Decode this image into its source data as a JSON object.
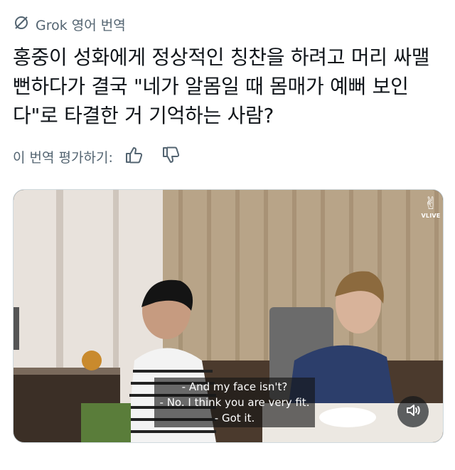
{
  "translate": {
    "label": "Grok 영어 번역"
  },
  "post": {
    "text": "홍중이 성화에게 정상적인 칭찬을 하려고 머리 싸맬 뻔하다가 결국 \"네가 알몸일 때 몸매가 예뻐 보인다\"로 타결한 거 기억하는 사람?"
  },
  "rating": {
    "label": "이 번역 평가하기:"
  },
  "video": {
    "badge_text": "VLIVE",
    "subtitles": [
      "- And my face isn't?",
      "- No. I think you are very fit.",
      "- Got it."
    ]
  },
  "icons": {
    "translate": "grok-slash-icon",
    "thumbs_up": "thumbs-up-icon",
    "thumbs_down": "thumbs-down-icon",
    "volume": "speaker-muted-icon"
  },
  "colors": {
    "text_primary": "#0f1419",
    "text_secondary": "#536471",
    "border": "#cfd9de"
  }
}
